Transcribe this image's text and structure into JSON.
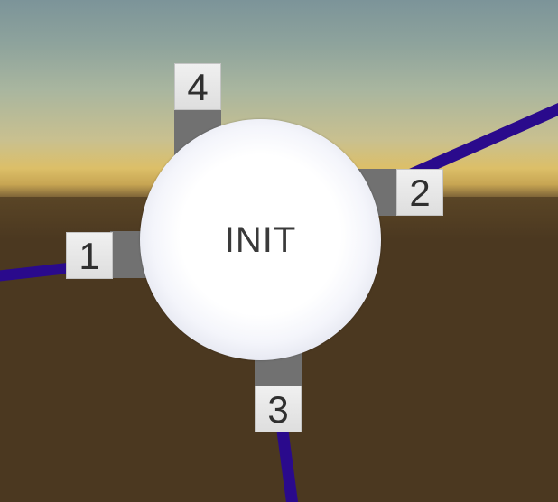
{
  "node": {
    "label": "INIT"
  },
  "ports": [
    {
      "id": "1",
      "label": "1",
      "side": "left"
    },
    {
      "id": "2",
      "label": "2",
      "side": "right"
    },
    {
      "id": "3",
      "label": "3",
      "side": "bottom"
    },
    {
      "id": "4",
      "label": "4",
      "side": "top"
    }
  ],
  "colors": {
    "wire": "#2a0a8c",
    "sphere": "#ffffff",
    "port_stub": "#717171",
    "port_label_bg": "#e8e8e8",
    "ground": "#4b3820",
    "sky": "#7c9499",
    "horizon": "#dcbf68"
  }
}
